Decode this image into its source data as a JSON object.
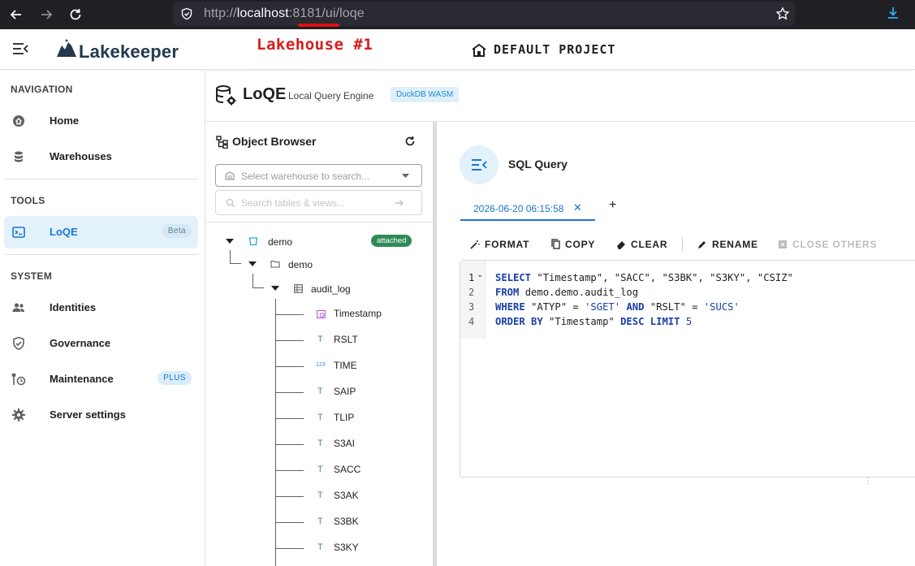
{
  "browser": {
    "url_prefix": "http://",
    "url_host": "localhost",
    "url_port": ":8181",
    "url_path": "/ui/loqe"
  },
  "header": {
    "logo": "Lakekeeper",
    "lakehouse_tag": "Lakehouse #1",
    "project": "DEFAULT PROJECT"
  },
  "sidebar": {
    "navigation_title": "NAVIGATION",
    "navigation": [
      {
        "label": "Home",
        "icon": "home-icon"
      },
      {
        "label": "Warehouses",
        "icon": "database-icon"
      }
    ],
    "tools_title": "TOOLS",
    "tools": [
      {
        "label": "LoQE",
        "icon": "terminal-icon",
        "badge": "Beta",
        "active": true
      }
    ],
    "system_title": "SYSTEM",
    "system": [
      {
        "label": "Identities",
        "icon": "people-icon"
      },
      {
        "label": "Governance",
        "icon": "shield-icon"
      },
      {
        "label": "Maintenance",
        "icon": "wrench-clock-icon",
        "badge": "PLUS"
      },
      {
        "label": "Server settings",
        "icon": "gear-icon"
      }
    ]
  },
  "page": {
    "title": "LoQE",
    "subtitle": "Local Query Engine",
    "chip": "DuckDB WASM"
  },
  "object_browser": {
    "title": "Object Browser",
    "warehouse_placeholder": "Select warehouse to search...",
    "search_placeholder": "Search tables & views...",
    "tree": {
      "warehouse": "demo",
      "warehouse_status": "attached",
      "namespace": "demo",
      "table": "audit_log",
      "columns": [
        {
          "name": "Timestamp",
          "type": "timestamp"
        },
        {
          "name": "RSLT",
          "type": "text"
        },
        {
          "name": "TIME",
          "type": "number"
        },
        {
          "name": "SAIP",
          "type": "text"
        },
        {
          "name": "TLIP",
          "type": "text"
        },
        {
          "name": "S3AI",
          "type": "text"
        },
        {
          "name": "SACC",
          "type": "text"
        },
        {
          "name": "S3AK",
          "type": "text"
        },
        {
          "name": "S3BK",
          "type": "text"
        },
        {
          "name": "S3KY",
          "type": "text"
        }
      ]
    }
  },
  "sql": {
    "title": "SQL Query",
    "tab_label": "2026-06-20 06:15:58",
    "toolbar": {
      "format": "FORMAT",
      "copy": "COPY",
      "clear": "CLEAR",
      "rename": "RENAME",
      "close_others": "CLOSE OTHERS"
    },
    "line_numbers": [
      "1",
      "2",
      "3",
      "4"
    ],
    "lines": [
      [
        {
          "t": "SELECT",
          "k": "kw"
        },
        {
          "t": " \"Timestamp\", \"SACC\", \"S3BK\", \"S3KY\", \"CSIZ\"",
          "k": ""
        }
      ],
      [
        {
          "t": "FROM",
          "k": "kw"
        },
        {
          "t": " demo.demo.audit_log",
          "k": ""
        }
      ],
      [
        {
          "t": "WHERE",
          "k": "kw"
        },
        {
          "t": " \"ATYP\" = ",
          "k": ""
        },
        {
          "t": "'SGET'",
          "k": "str"
        },
        {
          "t": " ",
          "k": ""
        },
        {
          "t": "AND",
          "k": "kw"
        },
        {
          "t": " \"RSLT\" = ",
          "k": ""
        },
        {
          "t": "'SUCS'",
          "k": "str"
        }
      ],
      [
        {
          "t": "ORDER BY",
          "k": "kw"
        },
        {
          "t": " \"Timestamp\" ",
          "k": ""
        },
        {
          "t": "DESC",
          "k": "kw"
        },
        {
          "t": " ",
          "k": ""
        },
        {
          "t": "LIMIT",
          "k": "kw"
        },
        {
          "t": " ",
          "k": ""
        },
        {
          "t": "5",
          "k": "str"
        }
      ]
    ]
  }
}
